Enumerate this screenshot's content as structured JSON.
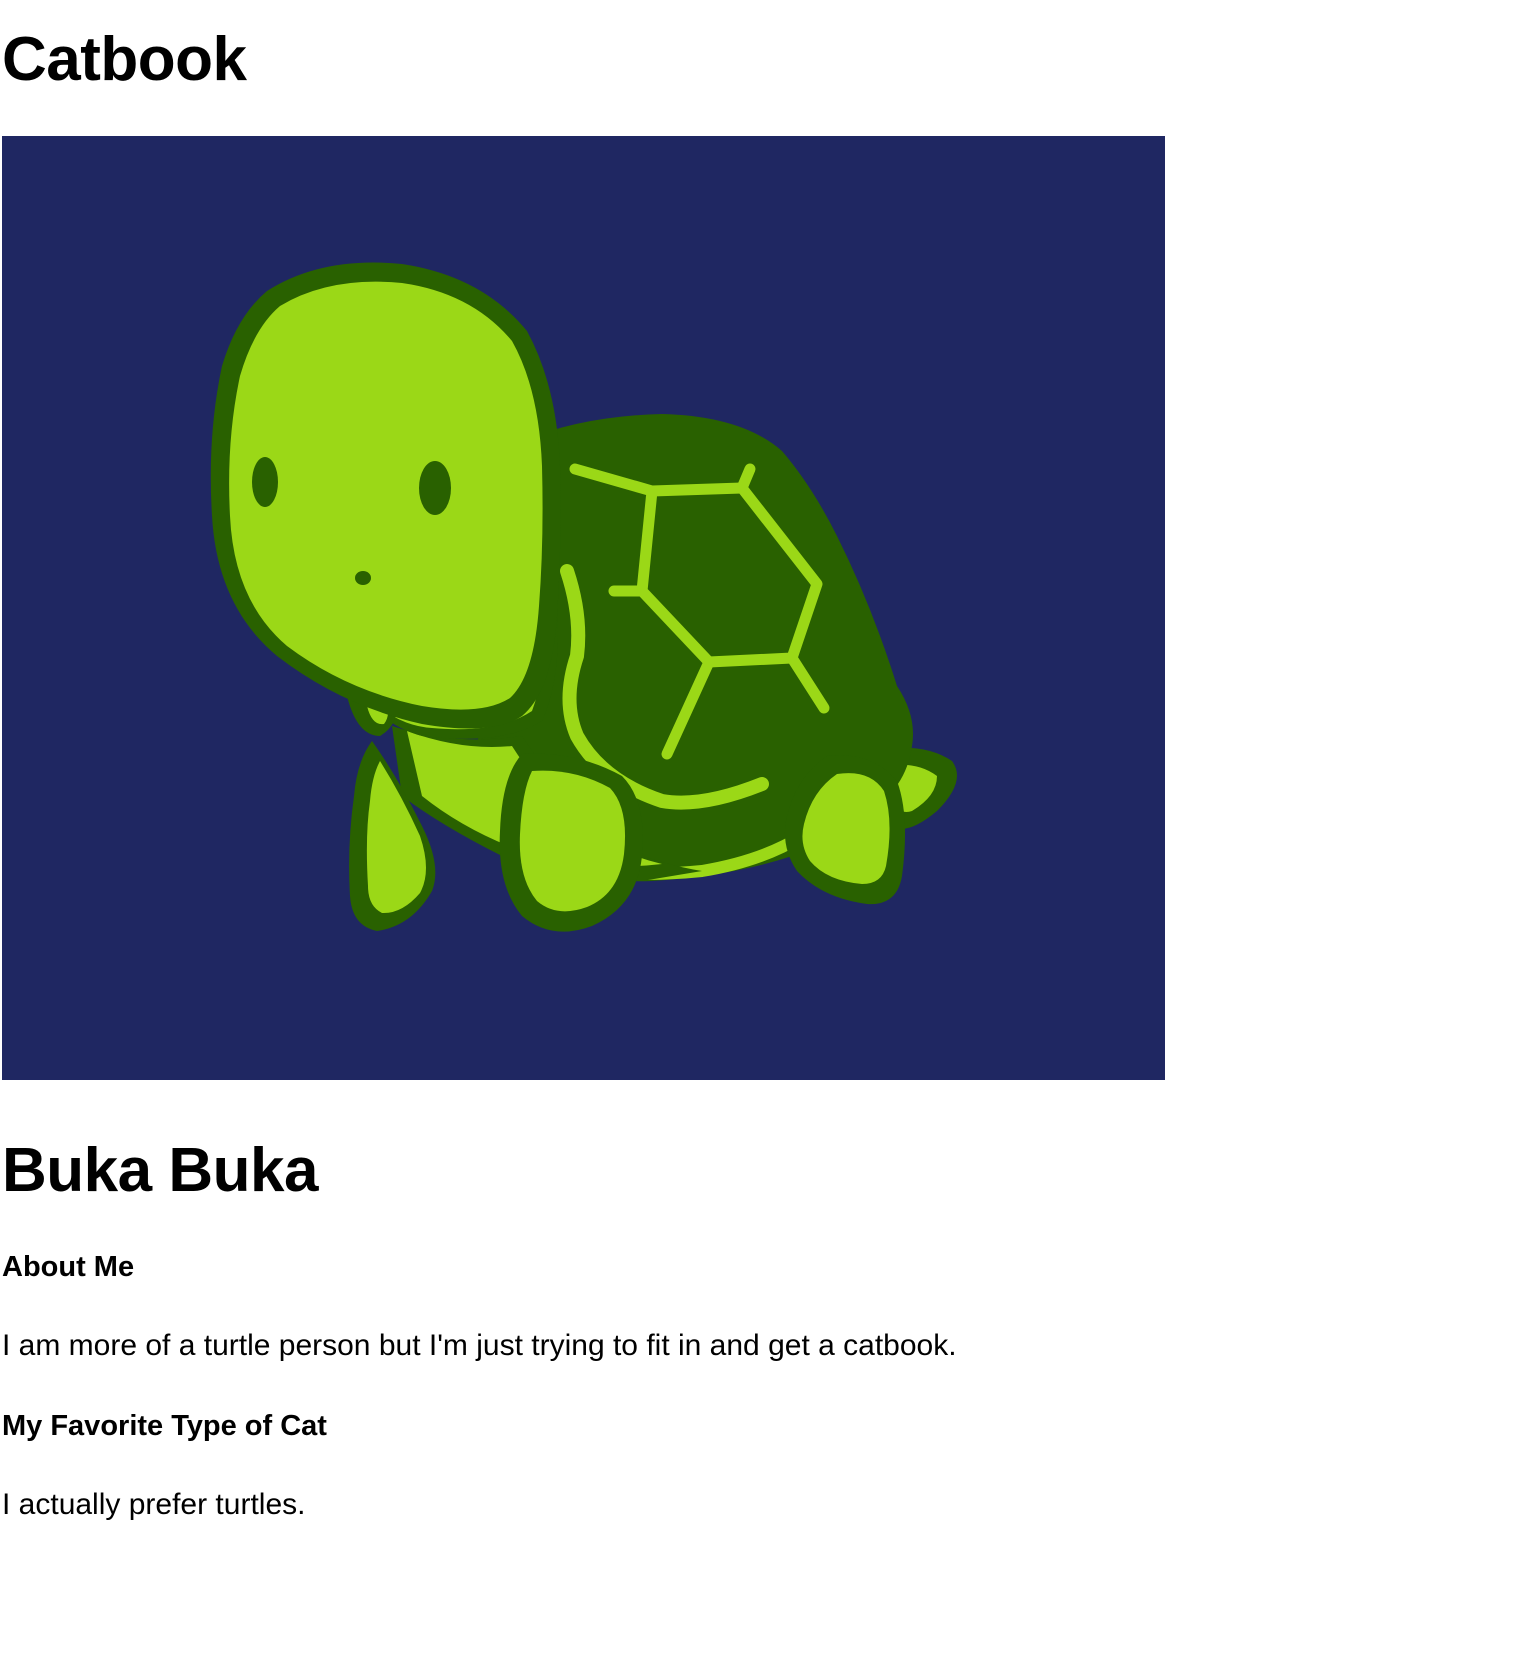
{
  "header": {
    "title": "Catbook"
  },
  "profile": {
    "image_icon": "turtle-illustration",
    "image_background": "#1f2762",
    "name": "Buka Buka",
    "about": {
      "heading": "About Me",
      "text": "I am more of a turtle person but I'm just trying to fit in and get a catbook."
    },
    "favorite_cat": {
      "heading": "My Favorite Type of Cat",
      "text": "I actually prefer turtles."
    }
  },
  "colors": {
    "turtle_light": "#9bd817",
    "turtle_dark": "#296100"
  }
}
